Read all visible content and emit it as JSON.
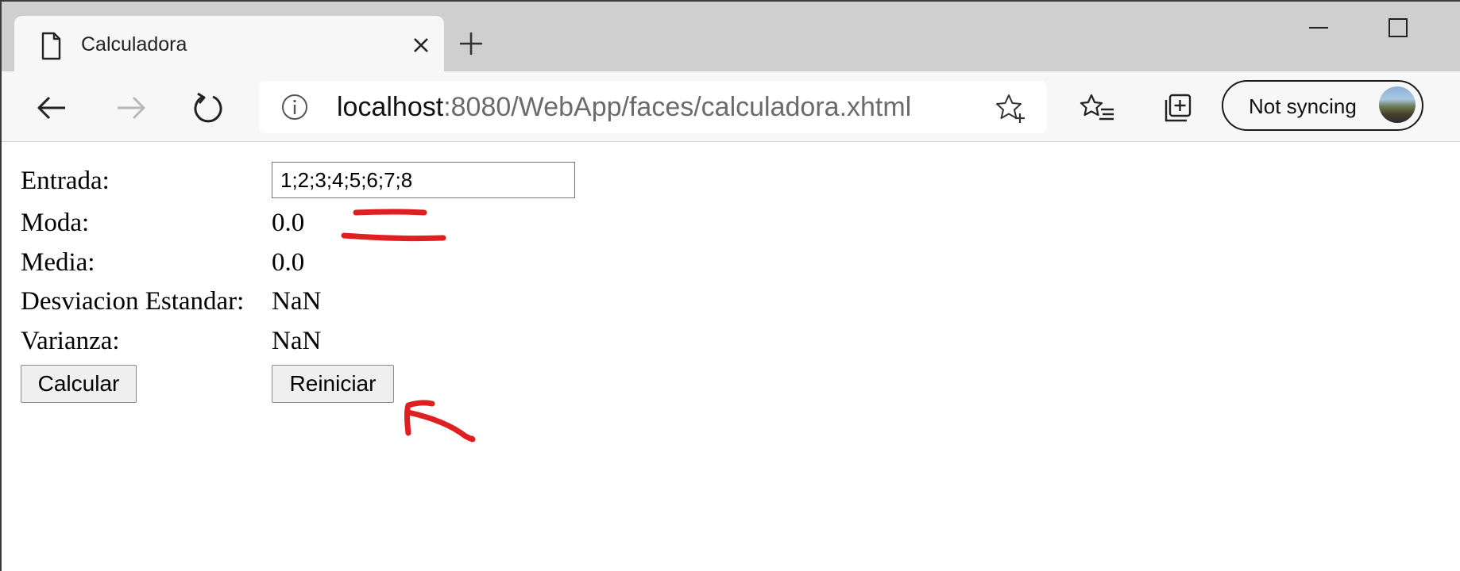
{
  "browser": {
    "tab": {
      "title": "Calculadora"
    },
    "address": {
      "host": "localhost",
      "rest": ":8080/WebApp/faces/calculadora.xhtml"
    },
    "profile": {
      "label": "Not syncing"
    }
  },
  "form": {
    "entrada": {
      "label": "Entrada:",
      "value": "1;2;3;4;5;6;7;8"
    },
    "moda": {
      "label": "Moda:",
      "value": "0.0"
    },
    "media": {
      "label": "Media:",
      "value": "0.0"
    },
    "desviacion": {
      "label": "Desviacion Estandar:",
      "value": "NaN"
    },
    "varianza": {
      "label": "Varianza:",
      "value": "NaN"
    },
    "calcular_label": "Calcular",
    "reiniciar_label": "Reiniciar"
  },
  "colors": {
    "annotation": "#e02020",
    "tabstrip": "#cfcfcf",
    "toolbar": "#f7f7f7"
  },
  "icons": [
    "page-icon",
    "close-icon",
    "plus-icon",
    "minimize-icon",
    "maximize-icon",
    "back-arrow-icon",
    "forward-arrow-icon",
    "refresh-icon",
    "info-icon",
    "add-favorite-icon",
    "favorites-icon",
    "collections-icon"
  ]
}
